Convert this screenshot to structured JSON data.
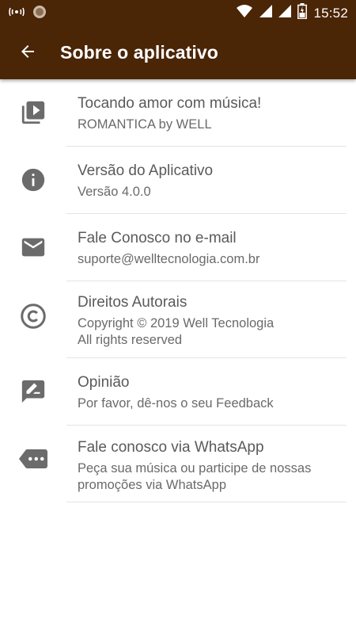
{
  "status_bar": {
    "time": "15:52",
    "icons": [
      "radio-wave-icon",
      "sun-icon",
      "wifi-icon",
      "signal-icon",
      "signal-icon",
      "battery-icon"
    ]
  },
  "toolbar": {
    "back_icon": "arrow-back-icon",
    "title": "Sobre o aplicativo"
  },
  "colors": {
    "app_bar": "#4a2506",
    "icon_gray": "#6b6b6b",
    "primary_text": "#5a5a5a",
    "secondary_text": "#6a6a6a"
  },
  "items": [
    {
      "icon": "playlist-play-icon",
      "title": "Tocando amor com música!",
      "subtitle": "ROMANTICA by WELL"
    },
    {
      "icon": "info-icon",
      "title": "Versão do Aplicativo",
      "subtitle": "Versão 4.0.0"
    },
    {
      "icon": "email-icon",
      "title": "Fale Conosco no e-mail",
      "subtitle": "suporte@welltecnologia.com.br"
    },
    {
      "icon": "copyright-icon",
      "title": "Direitos Autorais",
      "subtitle": "Copyright © 2019 Well Tecnologia\n All rights reserved"
    },
    {
      "icon": "feedback-icon",
      "title": "Opinião",
      "subtitle": "Por favor, dê-nos o seu Feedback"
    },
    {
      "icon": "chat-bubble-more-icon",
      "title": "Fale conosco via WhatsApp",
      "subtitle": "Peça sua música ou participe de nossas promoções via WhatsApp"
    }
  ]
}
